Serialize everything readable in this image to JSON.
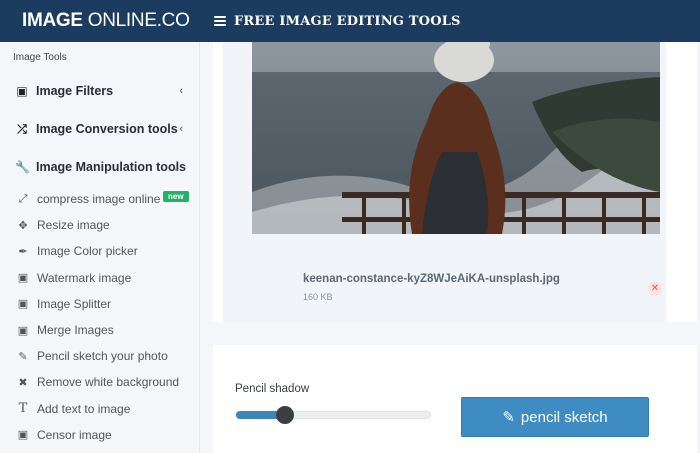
{
  "header": {
    "brand_bold": "IMAGE",
    "brand_light": " ONLINE.CO",
    "menu_icon": "hamburger-icon",
    "title": "FREE IMAGE EDITING TOOLS"
  },
  "sidebar": {
    "heading": "Image Tools",
    "sections": [
      {
        "label": "Image Filters",
        "icon": "image-icon"
      },
      {
        "label": "Image Conversion tools",
        "icon": "shuffle-icon"
      },
      {
        "label": "Image Manipulation tools",
        "icon": "wrench-icon"
      }
    ],
    "items": [
      {
        "label": "compress image online",
        "icon": "compress-icon",
        "badge": "new"
      },
      {
        "label": "Resize image",
        "icon": "arrows-icon"
      },
      {
        "label": "Image Color picker",
        "icon": "eyedropper-icon"
      },
      {
        "label": "Watermark image",
        "icon": "image-icon"
      },
      {
        "label": "Image Splitter",
        "icon": "image-icon"
      },
      {
        "label": "Merge Images",
        "icon": "image-icon"
      },
      {
        "label": "Pencil sketch your photo",
        "icon": "edit-icon"
      },
      {
        "label": "Remove white background",
        "icon": "close-icon"
      },
      {
        "label": "Add text to image",
        "icon": "text-icon"
      },
      {
        "label": "Censor image",
        "icon": "image-icon"
      }
    ]
  },
  "upload": {
    "filename": "keenan-constance-kyZ8WJeAiKA-unsplash.jpg",
    "filesize": "160 KB"
  },
  "controls": {
    "slider_label": "Pencil shadow",
    "slider_value": 0.25,
    "button_label": "pencil sketch",
    "accent": "#3e8cc2"
  }
}
